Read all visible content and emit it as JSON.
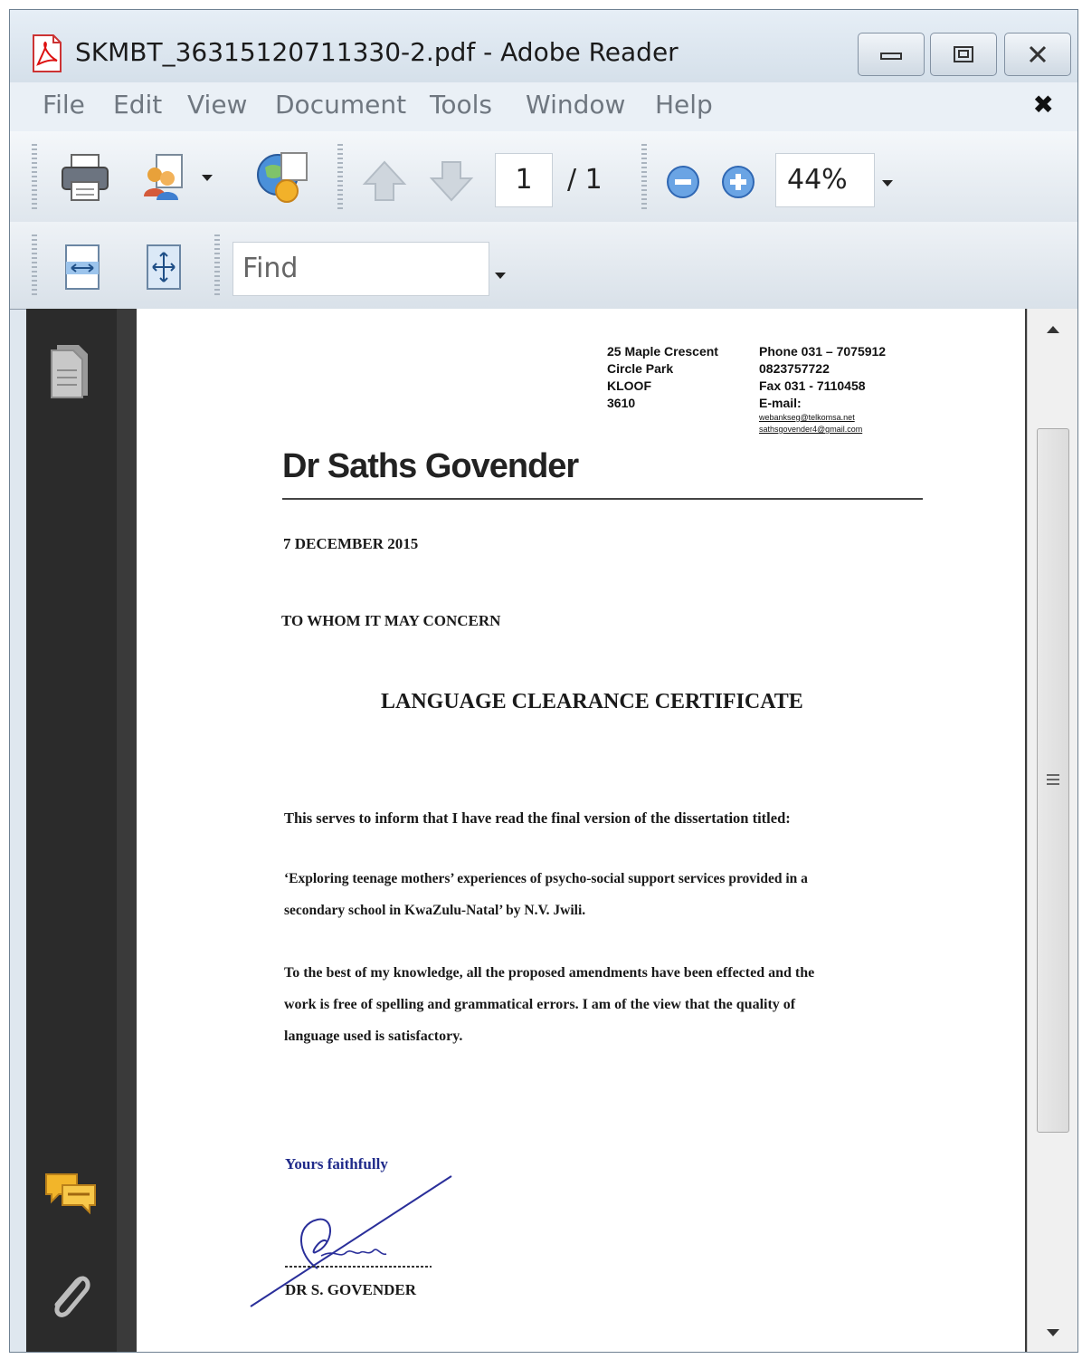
{
  "window": {
    "title": "SKMBT_36315120711330-2.pdf - Adobe Reader",
    "controls": [
      "minimize",
      "restore",
      "close"
    ]
  },
  "menubar": {
    "items": [
      "File",
      "Edit",
      "View",
      "Document",
      "Tools",
      "Window",
      "Help"
    ],
    "close_glyph": "✖"
  },
  "toolbar": {
    "page_current": "1",
    "page_total": "/ 1",
    "zoom": "44%",
    "find_placeholder": "Find",
    "icons": [
      "print-icon",
      "share-icon",
      "collaborate-icon",
      "previous-page-icon",
      "next-page-icon",
      "zoom-out-icon",
      "zoom-in-icon",
      "fit-width-icon",
      "fit-page-icon"
    ]
  },
  "sidebar": {
    "icons": [
      "pages-icon",
      "comments-icon",
      "attachments-icon"
    ]
  },
  "document": {
    "address_lines": [
      "25 Maple Crescent",
      "Circle Park",
      "KLOOF",
      "3610"
    ],
    "contact_lines": [
      "Phone 031 – 7075912",
      "0823757722",
      "Fax 031 - 7110458",
      "E-mail:"
    ],
    "emails": [
      "webankseg@telkomsa.net",
      "sathsgovender4@gmail.com"
    ],
    "letterhead_name": "Dr Saths Govender",
    "date": "7 DECEMBER 2015",
    "salutation": "TO WHOM IT MAY CONCERN",
    "heading": "LANGUAGE CLEARANCE CERTIFICATE",
    "para1": "This serves to inform that I have read the final version of the dissertation titled:",
    "title_line1": "‘Exploring teenage mothers’ experiences of psycho-social support services provided in a",
    "title_line2": "secondary school in KwaZulu-Natal’  by N.V. Jwili.",
    "para2_line1": "To the best of my knowledge, all the proposed amendments have been effected and the",
    "para2_line2": "work is free of spelling and grammatical errors.  I am of the view that the quality of",
    "para2_line3": "language used is satisfactory.",
    "closing": "Yours faithfully",
    "signature_text": "Govender",
    "signatory": "DR S. GOVENDER",
    "colors": {
      "ink_blue": "#2a2f9a",
      "text": "#1a1a1a"
    }
  }
}
